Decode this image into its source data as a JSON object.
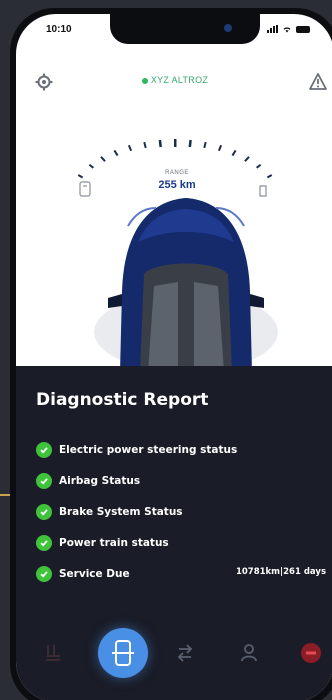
{
  "status_bar": {
    "time": "10:10"
  },
  "header": {
    "car_name": "XYZ ALTROZ"
  },
  "range": {
    "label": "RANGE",
    "value": "255 km"
  },
  "diagnostic": {
    "title": "Diagnostic Report",
    "items": [
      {
        "label": "Electric power steering status",
        "extra": ""
      },
      {
        "label": "Airbag Status",
        "extra": ""
      },
      {
        "label": "Brake System Status",
        "extra": ""
      },
      {
        "label": "Power train status",
        "extra": ""
      },
      {
        "label": "Service Due",
        "extra": "10781km|261 days"
      }
    ]
  },
  "colors": {
    "accent": "#4a8fe6",
    "ok": "#3fc33b",
    "panel": "#1a1c27",
    "range_text": "#1e3a8a",
    "connector_line": "#c9a24a"
  },
  "tabs": [
    {
      "icon": "seat-icon"
    },
    {
      "icon": "phone-car-icon"
    },
    {
      "icon": "transfer-icon"
    },
    {
      "icon": "user-icon"
    },
    {
      "icon": "stop-icon"
    }
  ]
}
